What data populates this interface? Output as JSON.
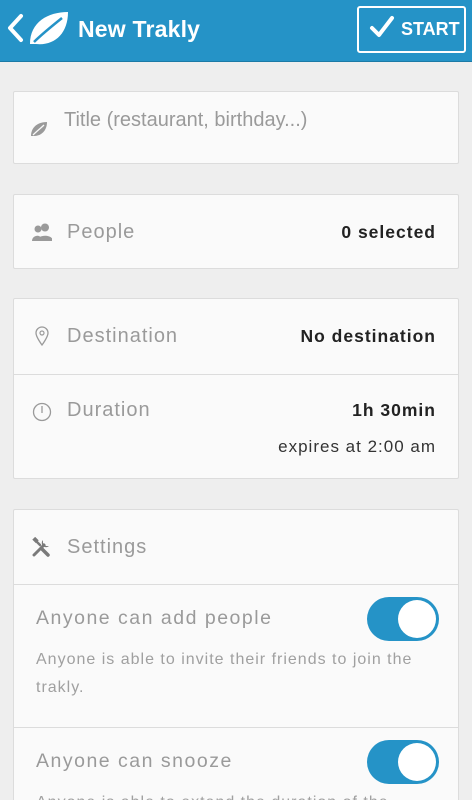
{
  "appbar": {
    "title": "New Trakly",
    "start_label": "START"
  },
  "title_field": {
    "placeholder": "Title (restaurant, birthday...)"
  },
  "people": {
    "label": "People",
    "value": "0 selected"
  },
  "destination": {
    "label": "Destination",
    "value": "No destination"
  },
  "duration": {
    "label": "Duration",
    "value": "1h 30min",
    "expires": "expires at 2:00 am"
  },
  "settings": {
    "header": "Settings",
    "items": [
      {
        "title": "Anyone can add people",
        "description": "Anyone is able to invite their friends to join the trakly.",
        "enabled": true
      },
      {
        "title": "Anyone can snooze",
        "description": "Anyone is able to extend the duration of the",
        "enabled": true
      }
    ]
  },
  "colors": {
    "primary": "#2593c7",
    "background": "#eeeeee",
    "card": "#fafafa"
  },
  "icons": [
    "back-arrow-icon",
    "leaf-icon",
    "checkmark-icon",
    "people-icon",
    "location-pin-icon",
    "clock-icon",
    "tools-icon"
  ]
}
